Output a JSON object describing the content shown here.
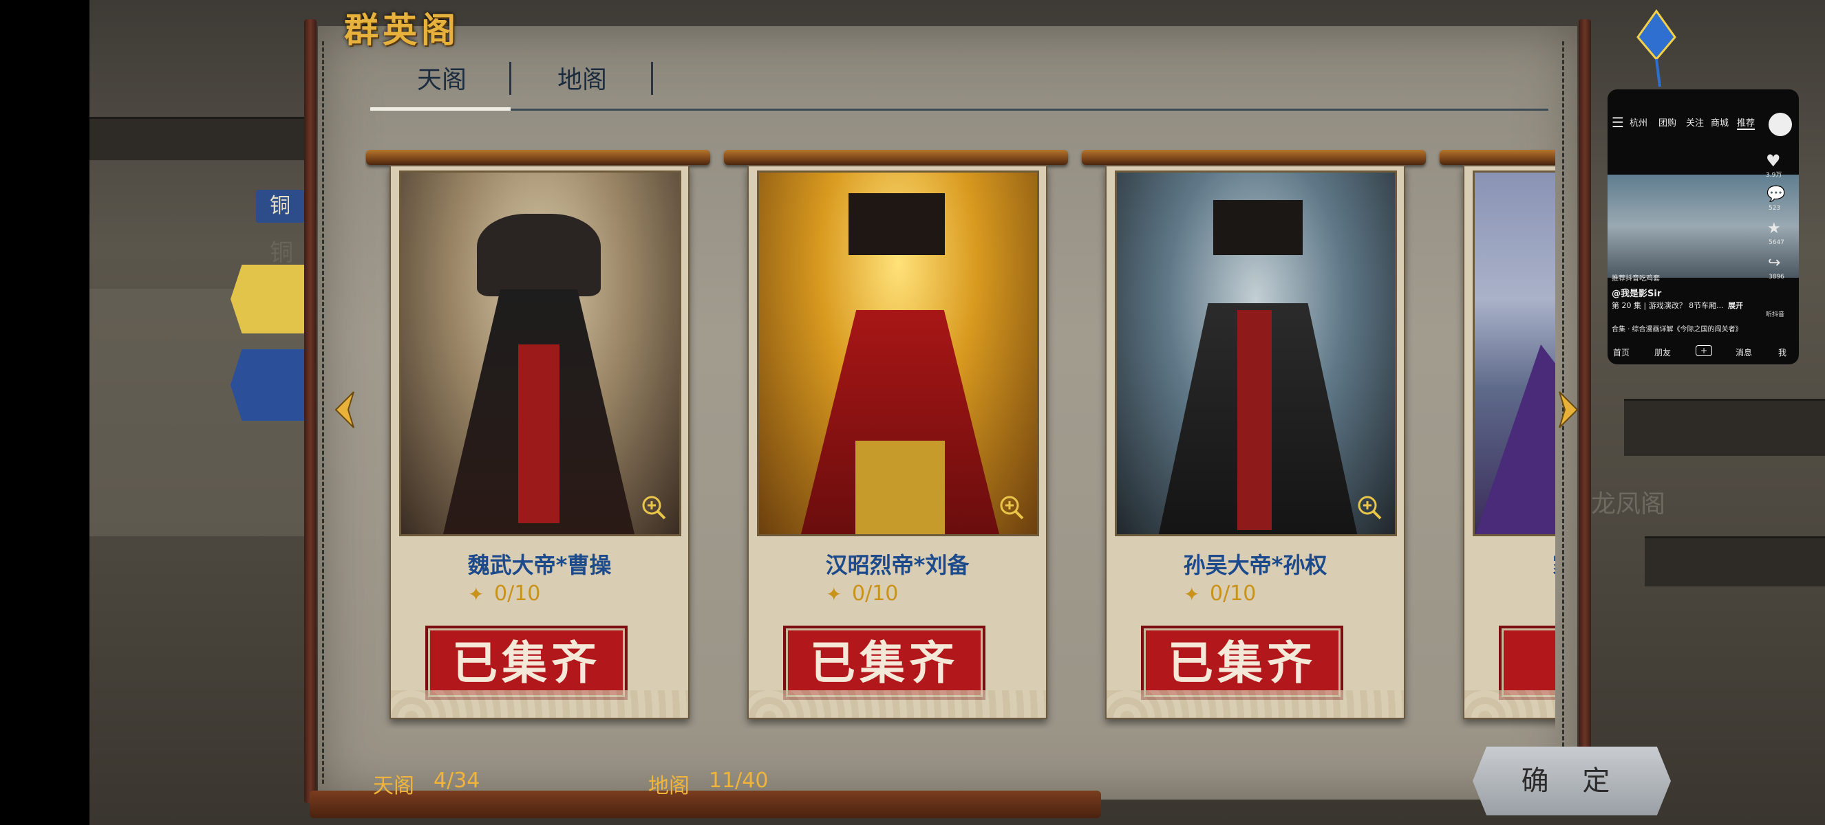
{
  "window": {
    "title": "群英阁"
  },
  "tabs": [
    {
      "label": "天阁",
      "active": true
    },
    {
      "label": "地阁",
      "active": false
    }
  ],
  "cards": [
    {
      "name": "魏武大帝*曹操",
      "progress": "0/10",
      "status": "已集齐"
    },
    {
      "name": "汉昭烈帝*刘备",
      "progress": "0/10",
      "status": "已集齐"
    },
    {
      "name": "孙吴大帝*孙权",
      "progress": "0/10",
      "status": "已集齐"
    },
    {
      "name": "家",
      "progress": "",
      "status": "已"
    }
  ],
  "footer": {
    "tian_label": "天阁",
    "tian_count": "4/34",
    "di_label": "地阁",
    "di_count": "11/40"
  },
  "confirm_label": "确 定",
  "background": {
    "left_labels": [
      "铜",
      "铜"
    ],
    "right_label": "龙凤阁"
  },
  "phone_overlay": {
    "top_tabs": [
      "杭州",
      "团购",
      "关注",
      "商城",
      "推荐"
    ],
    "likes": "3.9万",
    "comments": "523",
    "favorites": "5647",
    "shares": "3896",
    "caption_tag": "推荐抖音吃鸡套",
    "author": "@我是影Sir",
    "desc": "第 20 集 | 游戏演改？ 8节车厢...",
    "expand": "展开",
    "listen": "听抖音",
    "collection": "合集 · 综合漫画详解《今际之国的闯关者》",
    "bottom_nav": [
      "首页",
      "朋友",
      "+",
      "消息",
      "我"
    ]
  },
  "colors": {
    "accent": "#e6b13c",
    "stamp_red": "#b2171c",
    "name_blue": "#1c4a8a",
    "panel": "#a29c8f"
  }
}
